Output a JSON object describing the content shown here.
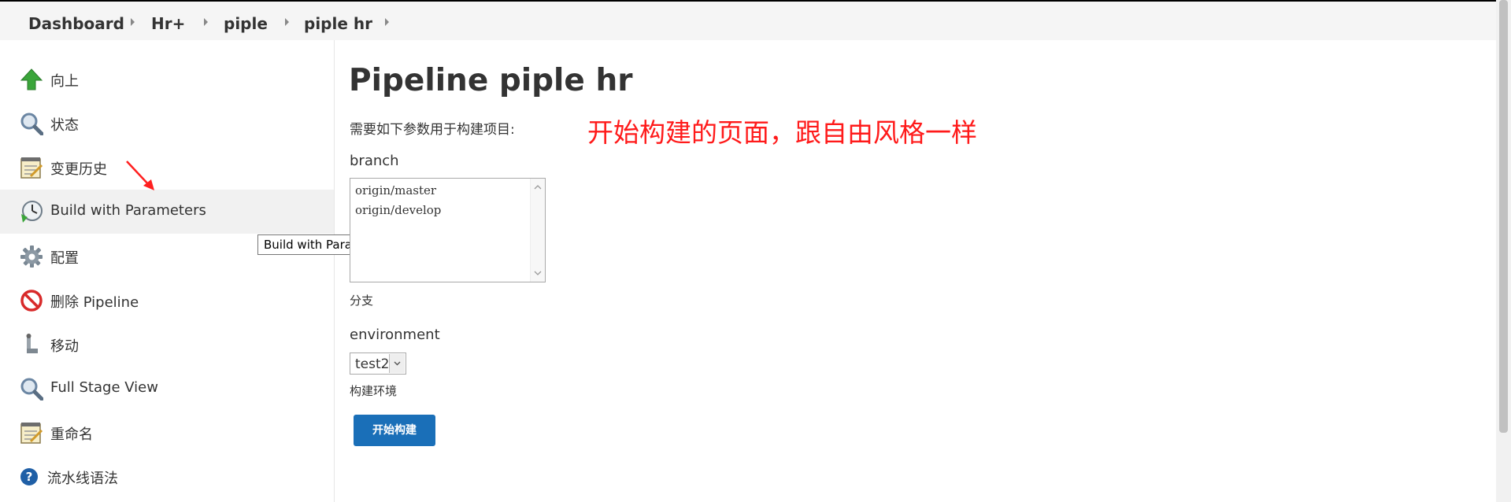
{
  "breadcrumb": {
    "items": [
      "Dashboard",
      "Hr+",
      "piple",
      "piple hr"
    ]
  },
  "sidebar": {
    "items": [
      {
        "label": "向上",
        "icon": "up-arrow-icon"
      },
      {
        "label": "状态",
        "icon": "magnifier-icon"
      },
      {
        "label": "变更历史",
        "icon": "notepad-icon"
      },
      {
        "label": "Build with Parameters",
        "icon": "clock-build-icon"
      },
      {
        "label": "配置",
        "icon": "gear-icon"
      },
      {
        "label": "删除 Pipeline",
        "icon": "no-entry-icon"
      },
      {
        "label": "移动",
        "icon": "move-icon"
      },
      {
        "label": "Full Stage View",
        "icon": "magnifier-icon"
      },
      {
        "label": "重命名",
        "icon": "notepad-icon"
      },
      {
        "label": "流水线语法",
        "icon": "help-icon"
      }
    ]
  },
  "tooltip": {
    "text": "Build with Parameters"
  },
  "main": {
    "title": "Pipeline piple hr",
    "intro": "需要如下参数用于构建项目:",
    "annotation": "开始构建的页面，跟自由风格一样",
    "annotation_color": "#ff1a1a",
    "params": {
      "branch": {
        "label": "branch",
        "options": [
          "origin/master",
          "origin/develop"
        ],
        "description": "分支"
      },
      "environment": {
        "label": "environment",
        "value": "test2",
        "description": "构建环境"
      }
    },
    "build_button": "开始构建",
    "button_color": "#1a6fb8"
  }
}
